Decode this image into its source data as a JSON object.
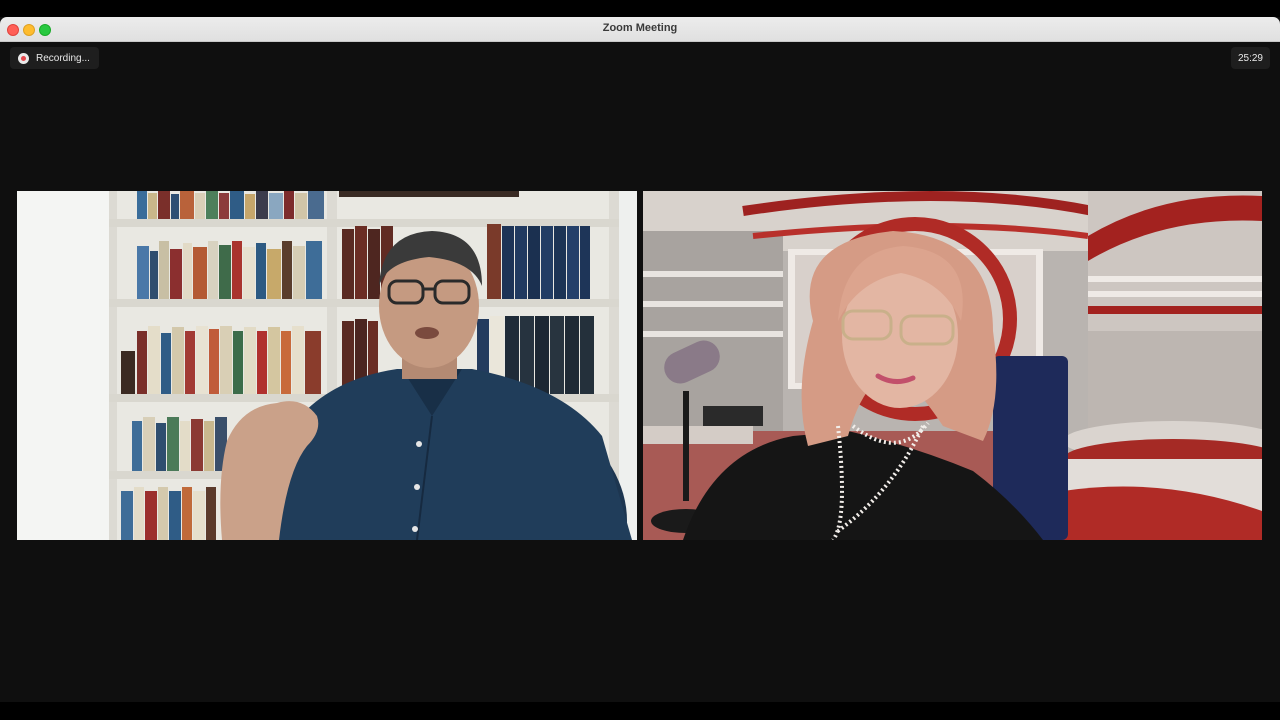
{
  "window": {
    "title": "Zoom Meeting"
  },
  "recording": {
    "label": "Recording..."
  },
  "timer": {
    "elapsed": "25:29"
  },
  "participants": [
    {
      "tile": "left",
      "video": "participant-man-bookshelf"
    },
    {
      "tile": "right",
      "video": "participant-woman-studio"
    }
  ],
  "colors": {
    "recording_dot": "#e5484d",
    "window_bg": "#0f0f0f"
  }
}
